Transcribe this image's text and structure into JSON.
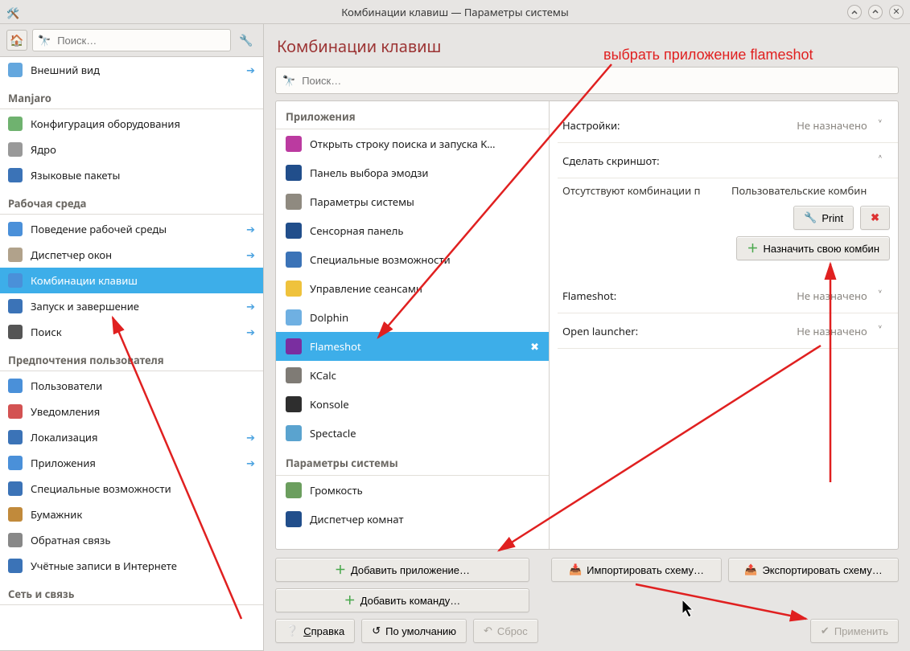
{
  "window": {
    "title": "Комбинации клавиш — Параметры системы"
  },
  "sidebar": {
    "search_placeholder": "Поиск…",
    "groups": [
      {
        "title": null,
        "items": [
          {
            "label": "Внешний вид",
            "icon_bg": "#64a7de",
            "arrow": true,
            "selected": false
          }
        ]
      },
      {
        "title": "Manjaro",
        "items": [
          {
            "label": "Конфигурация оборудования",
            "icon_bg": "#6fb26f",
            "arrow": false,
            "selected": false
          },
          {
            "label": "Ядро",
            "icon_bg": "#999999",
            "arrow": false,
            "selected": false
          },
          {
            "label": "Языковые пакеты",
            "icon_bg": "#3b73b7",
            "arrow": false,
            "selected": false
          }
        ]
      },
      {
        "title": "Рабочая среда",
        "items": [
          {
            "label": "Поведение рабочей среды",
            "icon_bg": "#4a90d9",
            "arrow": true,
            "selected": false
          },
          {
            "label": "Диспетчер окон",
            "icon_bg": "#b1a28b",
            "arrow": true,
            "selected": false
          },
          {
            "label": "Комбинации клавиш",
            "icon_bg": "#4a90d9",
            "arrow": false,
            "selected": true
          },
          {
            "label": "Запуск и завершение",
            "icon_bg": "#3b73b7",
            "arrow": true,
            "selected": false
          },
          {
            "label": "Поиск",
            "icon_bg": "#555555",
            "arrow": true,
            "selected": false
          }
        ]
      },
      {
        "title": "Предпочтения пользователя",
        "items": [
          {
            "label": "Пользователи",
            "icon_bg": "#4a90d9",
            "arrow": false,
            "selected": false
          },
          {
            "label": "Уведомления",
            "icon_bg": "#d35252",
            "arrow": false,
            "selected": false
          },
          {
            "label": "Локализация",
            "icon_bg": "#3b73b7",
            "arrow": true,
            "selected": false
          },
          {
            "label": "Приложения",
            "icon_bg": "#4a90d9",
            "arrow": true,
            "selected": false
          },
          {
            "label": "Специальные возможности",
            "icon_bg": "#3b73b7",
            "arrow": false,
            "selected": false
          },
          {
            "label": "Бумажник",
            "icon_bg": "#c18a3b",
            "arrow": false,
            "selected": false
          },
          {
            "label": "Обратная связь",
            "icon_bg": "#888888",
            "arrow": false,
            "selected": false
          },
          {
            "label": "Учётные записи в Интернете",
            "icon_bg": "#3b73b7",
            "arrow": false,
            "selected": false
          }
        ]
      },
      {
        "title": "Сеть и связь",
        "items": []
      }
    ]
  },
  "main": {
    "title": "Комбинации клавиш",
    "search_placeholder": "Поиск…",
    "app_groups": [
      {
        "title": "Приложения",
        "items": [
          {
            "label": "Открыть строку поиска и запуска K…",
            "icon_bg": "#bb3aa0",
            "selected": false,
            "removable": false
          },
          {
            "label": "Панель выбора эмодзи",
            "icon_bg": "#214e8b",
            "selected": false,
            "removable": false
          },
          {
            "label": "Параметры системы",
            "icon_bg": "#8f8a80",
            "selected": false,
            "removable": false
          },
          {
            "label": "Сенсорная панель",
            "icon_bg": "#214e8b",
            "selected": false,
            "removable": false
          },
          {
            "label": "Специальные возможности",
            "icon_bg": "#3b73b7",
            "selected": false,
            "removable": false
          },
          {
            "label": "Управление сеансами",
            "icon_bg": "#efc23c",
            "selected": false,
            "removable": false
          },
          {
            "label": "Dolphin",
            "icon_bg": "#6fb0e2",
            "selected": false,
            "removable": false
          },
          {
            "label": "Flameshot",
            "icon_bg": "#7a2ea0",
            "selected": true,
            "removable": true
          },
          {
            "label": "KCalc",
            "icon_bg": "#7f7b75",
            "selected": false,
            "removable": false
          },
          {
            "label": "Konsole",
            "icon_bg": "#2e2e2e",
            "selected": false,
            "removable": false
          },
          {
            "label": "Spectacle",
            "icon_bg": "#5aa3cf",
            "selected": false,
            "removable": false
          }
        ]
      },
      {
        "title": "Параметры системы",
        "items": [
          {
            "label": "Громкость",
            "icon_bg": "#6b9e5e",
            "selected": false,
            "removable": false
          },
          {
            "label": "Диспетчер комнат",
            "icon_bg": "#214e8b",
            "selected": false,
            "removable": false
          }
        ]
      }
    ],
    "shortcuts": [
      {
        "name": "Настройки:",
        "value": "Не назначено",
        "expanded": false
      },
      {
        "name": "Сделать скриншот:",
        "value": "",
        "expanded": true
      },
      {
        "name": "Flameshot:",
        "value": "Не назначено",
        "expanded": false
      },
      {
        "name": "Open launcher:",
        "value": "Не назначено",
        "expanded": false
      }
    ],
    "detail": {
      "status_left": "Отсутствуют комбинации п",
      "status_right": "Пользовательские комбин",
      "print_label": "Print",
      "assign_label": "Назначить свою комбин"
    },
    "buttons": {
      "add_app": "Добавить приложение…",
      "add_cmd": "Добавить команду…",
      "import": "Импортировать схему…",
      "export": "Экспортировать схему…"
    },
    "footer": {
      "help": "Справка",
      "defaults": "По умолчанию",
      "reset": "Сброс",
      "apply": "Применить"
    }
  },
  "annotations": {
    "select_flameshot": "выбрать приложение flameshot"
  }
}
